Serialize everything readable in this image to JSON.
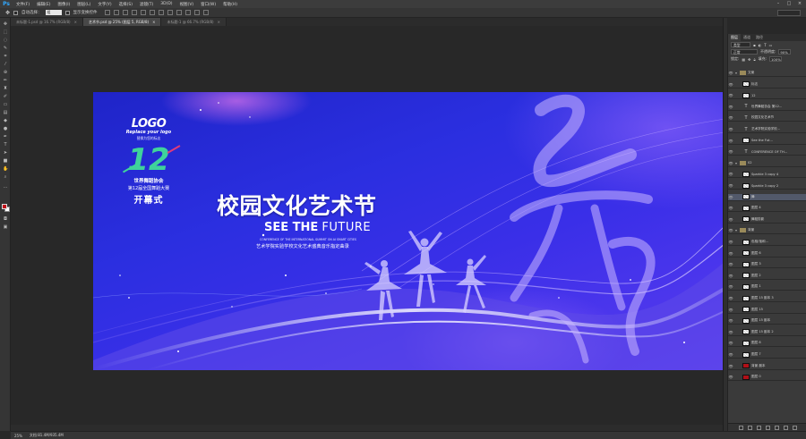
{
  "app": {
    "logo": "Ps"
  },
  "menu": [
    "文件(F)",
    "编辑(E)",
    "图像(I)",
    "图层(L)",
    "文字(Y)",
    "选择(S)",
    "滤镜(T)",
    "3D(D)",
    "视图(V)",
    "窗口(W)",
    "帮助(H)"
  ],
  "options_bar": {
    "auto_select_label": "自动选择：",
    "auto_select_value": "组",
    "transform_label": "显示变换控件"
  },
  "tabs": [
    {
      "label": "未标题-1.psd @ 16.7% (RGB/8)",
      "active": false
    },
    {
      "label": "艺术节.psd @ 25% (图层 5, RGB/8)",
      "active": true
    },
    {
      "label": "未标题-1 @ 66.7% (RGB/8)",
      "active": false
    }
  ],
  "poster": {
    "logo": "LOGO",
    "logo_sub1": "Replace your logo",
    "logo_sub2": "替换为您的标志",
    "number": "12",
    "org": "世界舞蹈协会",
    "event": "第12届全国舞蹈大赛",
    "opening": "开幕式",
    "title": "校园文化艺术节",
    "en_bold": "SEE THE",
    "en_light": "FUTURE",
    "en_small": "CONFERENCE OF THE INTERNATIONAL SUMMIT ON AI SMART CITIES",
    "cn_sub": "艺术学院实验学校文化艺术盛典音乐指定曲录"
  },
  "panels": {
    "tabs": [
      "图层",
      "通道",
      "路径"
    ],
    "kind_label": "类型",
    "blend_mode": "正常",
    "opacity_label": "不透明度:",
    "opacity": "90%",
    "lock_label": "锁定:",
    "fill_label": "填充:",
    "fill": "100%",
    "layers": [
      {
        "name": "文案",
        "type": "folder",
        "indent": 0
      },
      {
        "name": "标志",
        "type": "ps",
        "indent": 1
      },
      {
        "name": "12",
        "type": "ps",
        "indent": 1
      },
      {
        "name": "世界舞蹈协会 第12...",
        "type": "text",
        "indent": 1
      },
      {
        "name": "校园文化艺术节",
        "type": "text",
        "indent": 1
      },
      {
        "name": "艺术学院实验学校...",
        "type": "text",
        "indent": 1
      },
      {
        "name": "See the Fut...",
        "type": "ps",
        "indent": 1
      },
      {
        "name": "CONFERENCE OF TH...",
        "type": "text",
        "indent": 1
      },
      {
        "name": "02",
        "type": "folder",
        "indent": 0
      },
      {
        "name": "Sparkle 3 copy 4",
        "type": "ps",
        "indent": 1
      },
      {
        "name": "Sparkle 3 copy 2",
        "type": "ps",
        "indent": 1
      },
      {
        "name": "舞",
        "type": "ps",
        "indent": 1,
        "selected": true
      },
      {
        "name": "图层 4",
        "type": "ps",
        "indent": 1
      },
      {
        "name": "舞蹈剪影",
        "type": "ps",
        "indent": 1
      },
      {
        "name": "背景",
        "type": "folder",
        "indent": 0
      },
      {
        "name": "色相/饱和...",
        "type": "ps",
        "indent": 1
      },
      {
        "name": "图层 6",
        "type": "ps",
        "indent": 1
      },
      {
        "name": "图层 3",
        "type": "ps",
        "indent": 1
      },
      {
        "name": "图层 2",
        "type": "ps",
        "indent": 1
      },
      {
        "name": "图层 1",
        "type": "ps",
        "indent": 1
      },
      {
        "name": "图层 15 副本 3",
        "type": "ps",
        "indent": 1
      },
      {
        "name": "图层 15",
        "type": "ps",
        "indent": 1
      },
      {
        "name": "图层 15 副本",
        "type": "ps",
        "indent": 1
      },
      {
        "name": "图层 15 副本 2",
        "type": "ps",
        "indent": 1
      },
      {
        "name": "图层 8",
        "type": "ps",
        "indent": 1
      },
      {
        "name": "图层 7",
        "type": "ps",
        "indent": 1
      },
      {
        "name": "背景 副本",
        "type": "dark",
        "indent": 1
      },
      {
        "name": "图层 0",
        "type": "dark",
        "indent": 1
      }
    ]
  },
  "status": {
    "zoom": "25%",
    "doc": "文档:81.4M/935.4M"
  },
  "colors": {
    "accent_green": "#3fd39b",
    "accent_pink": "#e03a7a",
    "foreground": "#c0101a"
  }
}
